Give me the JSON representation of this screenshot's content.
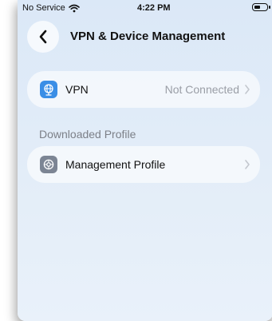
{
  "status_bar": {
    "carrier": "No Service",
    "time": "4:22 PM"
  },
  "header": {
    "title": "VPN & Device Management"
  },
  "vpn_row": {
    "label": "VPN",
    "value": "Not Connected",
    "icon": "globe-icon",
    "icon_color": "#3a8ee6"
  },
  "downloaded_section": {
    "header": "Downloaded Profile"
  },
  "profile_row": {
    "label": "Management Profile",
    "icon": "gear-icon",
    "icon_color": "#7c8594"
  }
}
